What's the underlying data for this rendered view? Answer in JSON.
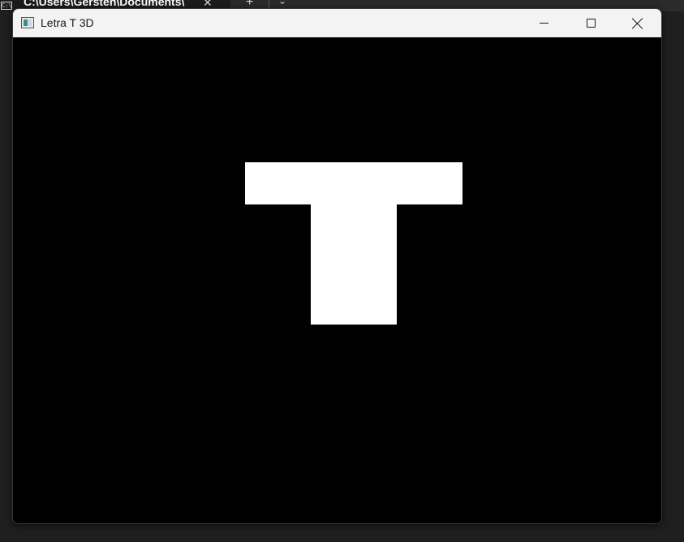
{
  "background_terminal": {
    "tab_title": "C:\\Users\\Gersten\\Documents\\",
    "tab_icon": "C:\\",
    "close_icon": "close-icon",
    "new_tab_icon": "plus-icon",
    "dropdown_icon": "chevron-down-icon"
  },
  "window": {
    "title": "Letra T 3D",
    "icon": "app-window-icon",
    "controls": {
      "minimize": "minimize-icon",
      "maximize": "maximize-icon",
      "close": "close-icon"
    }
  },
  "scene": {
    "background_color": "#000000",
    "shape_color": "#ffffff",
    "shape": "letter-T"
  }
}
